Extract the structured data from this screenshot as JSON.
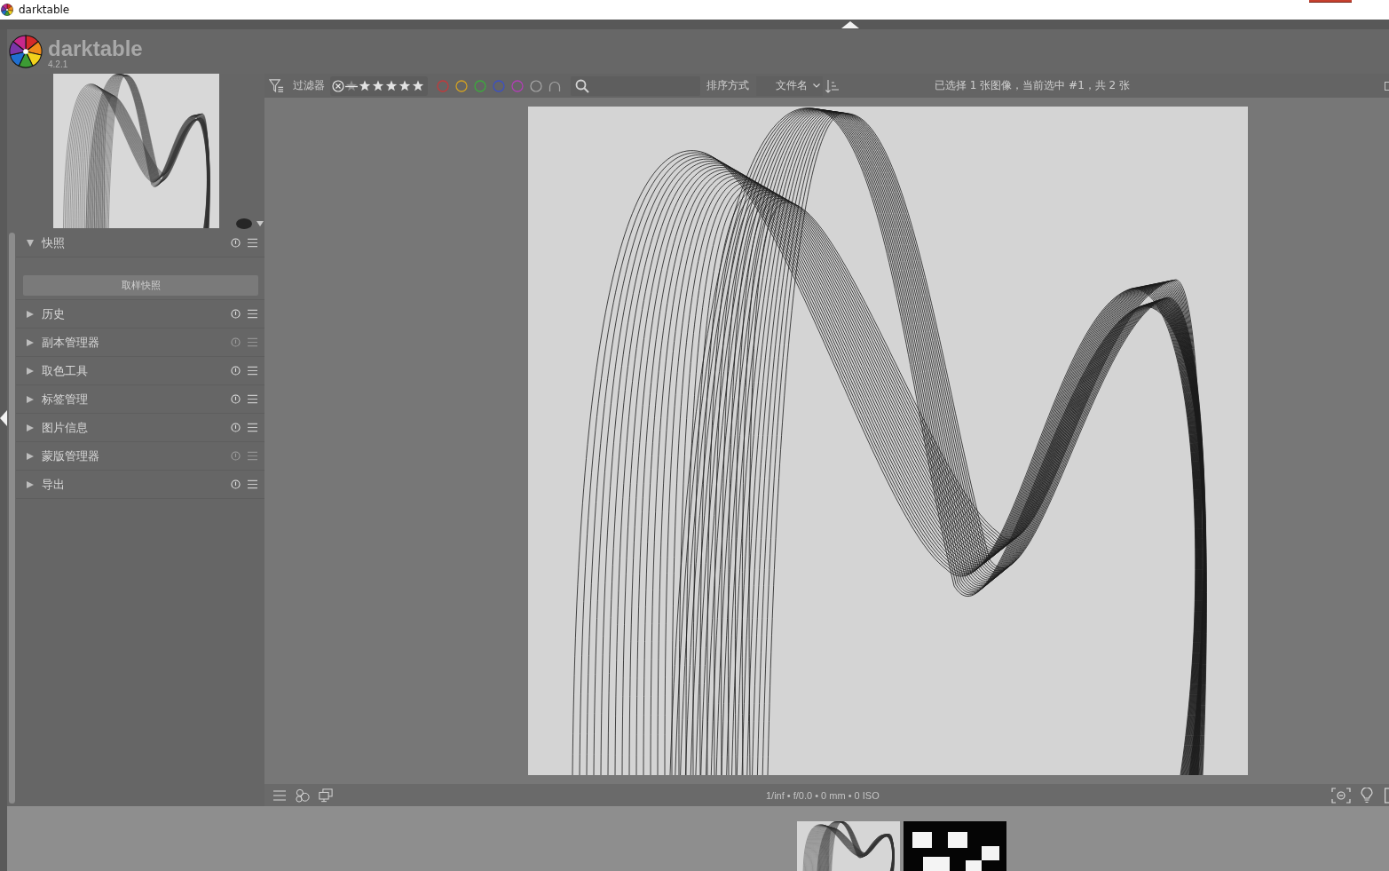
{
  "window": {
    "title": "darktable"
  },
  "header": {
    "app_name": "darktable",
    "version": "4.2.1"
  },
  "toolbar": {
    "filter_label": "过滤器",
    "color_labels": [
      {
        "color": "#c23a3c"
      },
      {
        "color": "#d0a024"
      },
      {
        "color": "#3caa3c"
      },
      {
        "color": "#3c50c4"
      },
      {
        "color": "#b040b4"
      }
    ],
    "sort_label": "排序方式",
    "sort_value": "文件名",
    "selection_status": "已选择 1 张图像，当前选中 #1，共 2 张"
  },
  "left_panel": {
    "modules": [
      {
        "label": "快照",
        "expanded": true,
        "dimmed": false,
        "button": "取样快照"
      },
      {
        "label": "历史",
        "expanded": false,
        "dimmed": false
      },
      {
        "label": "副本管理器",
        "expanded": false,
        "dimmed": true
      },
      {
        "label": "取色工具",
        "expanded": false,
        "dimmed": false
      },
      {
        "label": "标签管理",
        "expanded": false,
        "dimmed": false
      },
      {
        "label": "图片信息",
        "expanded": false,
        "dimmed": false
      },
      {
        "label": "蒙版管理器",
        "expanded": false,
        "dimmed": true
      },
      {
        "label": "导出",
        "expanded": false,
        "dimmed": false
      }
    ]
  },
  "bottom_bar": {
    "image_info": "1/inf • f/0.0 • 0 mm • 0 ISO"
  },
  "filmstrip": {
    "thumbnails": [
      {
        "kind": "line-art"
      },
      {
        "kind": "pattern"
      }
    ]
  }
}
